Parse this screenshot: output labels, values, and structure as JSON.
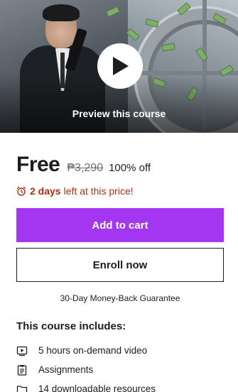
{
  "preview": {
    "label": "Preview this course"
  },
  "pricing": {
    "current": "Free",
    "original": "₱3,290",
    "discount": "100% off"
  },
  "timer": {
    "days": "2 days",
    "rest": "left at this price!"
  },
  "buttons": {
    "add_to_cart": "Add to cart",
    "enroll_now": "Enroll now"
  },
  "guarantee": "30-Day Money-Back Guarantee",
  "includes": {
    "title": "This course includes:",
    "items": [
      {
        "icon": "video-icon",
        "label": "5 hours on-demand video"
      },
      {
        "icon": "assignment-icon",
        "label": "Assignments"
      },
      {
        "icon": "folder-icon",
        "label": "14 downloadable resources"
      }
    ]
  },
  "colors": {
    "accent": "#a435f0",
    "timer": "#b32d0f"
  }
}
